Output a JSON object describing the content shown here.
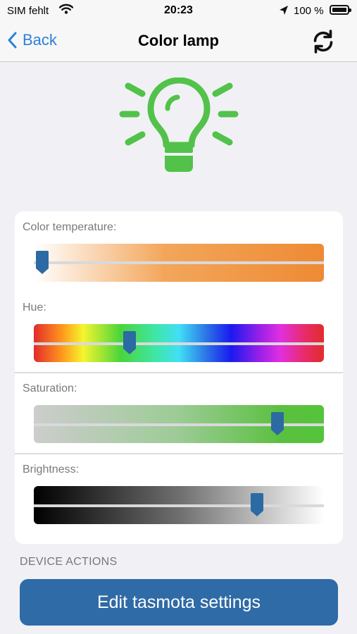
{
  "status_bar": {
    "carrier": "SIM fehlt",
    "time": "20:23",
    "battery": "100 %"
  },
  "nav": {
    "back_label": "Back",
    "title": "Color lamp",
    "refresh_icon": "refresh-icon"
  },
  "colors": {
    "accent": "#2f80d8",
    "bulb": "#52c24a",
    "button": "#2f6ba6",
    "thumb": "#2b6aa3"
  },
  "sliders": [
    {
      "label": "Color temperature:",
      "value": 0.03
    },
    {
      "label": "Hue:",
      "value": 0.33
    },
    {
      "label": "Saturation:",
      "value": 0.84
    },
    {
      "label": "Brightness:",
      "value": 0.77
    }
  ],
  "section_header": "DEVICE ACTIONS",
  "action_button": "Edit tasmota settings"
}
